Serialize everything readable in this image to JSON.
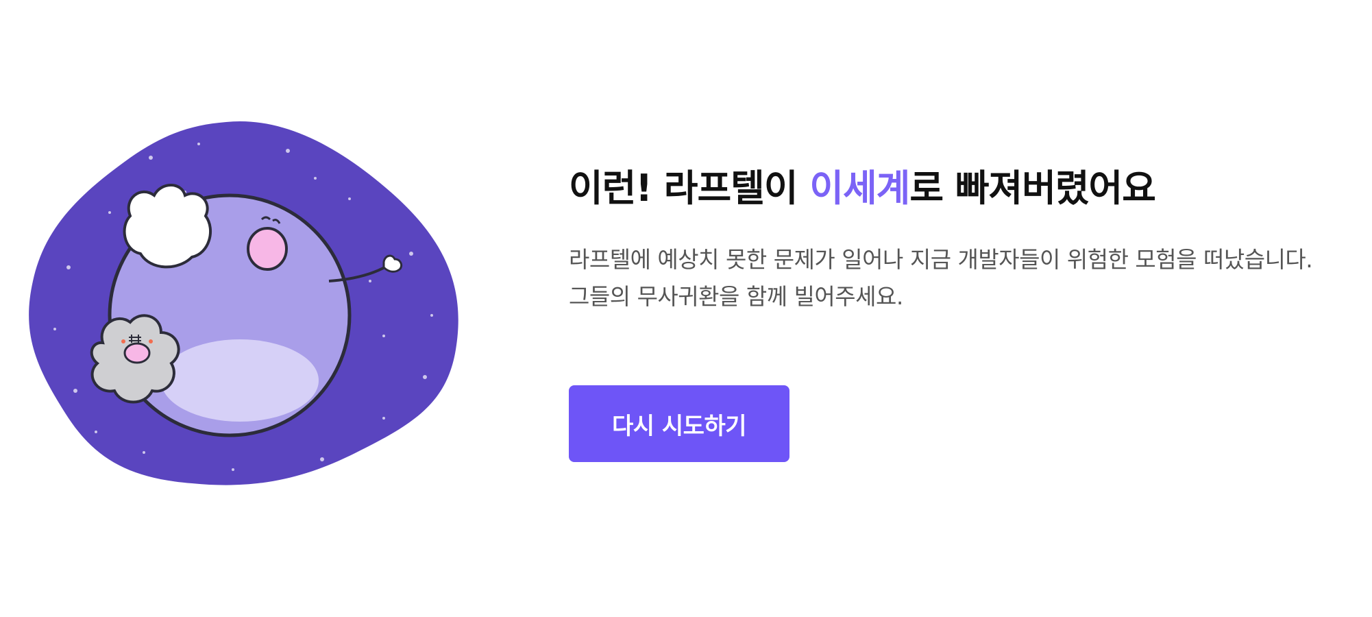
{
  "error_page": {
    "headline": {
      "prefix": "이런! 라프텔이 ",
      "highlight": "이세계",
      "suffix": "로 빠져버렸어요"
    },
    "description": {
      "line1": "라프텔에 예상치 못한 문제가 일어나 지금 개발자들이 위험한 모험을 떠났습니다.",
      "line2": "그들의 무사귀환을 함께 빌어주세요."
    },
    "retry_button_label": "다시 시도하기"
  },
  "illustration": {
    "icon": "planet-character-illustration"
  },
  "colors": {
    "accent": "#7b63f6",
    "button": "#6e55f7",
    "space_background": "#5a45bf",
    "planet": "#a99ee9",
    "headline_text": "#111111",
    "body_text": "#555555"
  }
}
